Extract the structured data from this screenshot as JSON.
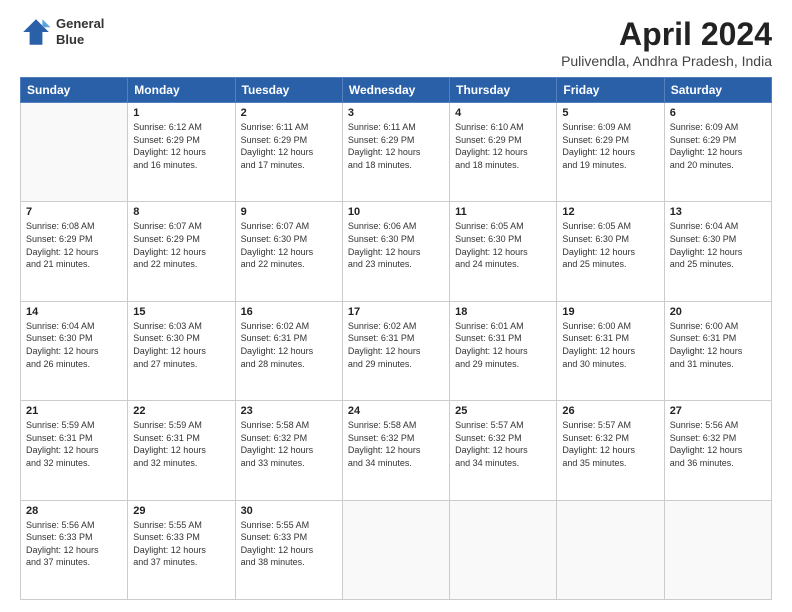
{
  "logo": {
    "line1": "General",
    "line2": "Blue"
  },
  "title": "April 2024",
  "location": "Pulivendla, Andhra Pradesh, India",
  "weekdays": [
    "Sunday",
    "Monday",
    "Tuesday",
    "Wednesday",
    "Thursday",
    "Friday",
    "Saturday"
  ],
  "weeks": [
    [
      {
        "day": "",
        "text": ""
      },
      {
        "day": "1",
        "text": "Sunrise: 6:12 AM\nSunset: 6:29 PM\nDaylight: 12 hours\nand 16 minutes."
      },
      {
        "day": "2",
        "text": "Sunrise: 6:11 AM\nSunset: 6:29 PM\nDaylight: 12 hours\nand 17 minutes."
      },
      {
        "day": "3",
        "text": "Sunrise: 6:11 AM\nSunset: 6:29 PM\nDaylight: 12 hours\nand 18 minutes."
      },
      {
        "day": "4",
        "text": "Sunrise: 6:10 AM\nSunset: 6:29 PM\nDaylight: 12 hours\nand 18 minutes."
      },
      {
        "day": "5",
        "text": "Sunrise: 6:09 AM\nSunset: 6:29 PM\nDaylight: 12 hours\nand 19 minutes."
      },
      {
        "day": "6",
        "text": "Sunrise: 6:09 AM\nSunset: 6:29 PM\nDaylight: 12 hours\nand 20 minutes."
      }
    ],
    [
      {
        "day": "7",
        "text": "Sunrise: 6:08 AM\nSunset: 6:29 PM\nDaylight: 12 hours\nand 21 minutes."
      },
      {
        "day": "8",
        "text": "Sunrise: 6:07 AM\nSunset: 6:29 PM\nDaylight: 12 hours\nand 22 minutes."
      },
      {
        "day": "9",
        "text": "Sunrise: 6:07 AM\nSunset: 6:30 PM\nDaylight: 12 hours\nand 22 minutes."
      },
      {
        "day": "10",
        "text": "Sunrise: 6:06 AM\nSunset: 6:30 PM\nDaylight: 12 hours\nand 23 minutes."
      },
      {
        "day": "11",
        "text": "Sunrise: 6:05 AM\nSunset: 6:30 PM\nDaylight: 12 hours\nand 24 minutes."
      },
      {
        "day": "12",
        "text": "Sunrise: 6:05 AM\nSunset: 6:30 PM\nDaylight: 12 hours\nand 25 minutes."
      },
      {
        "day": "13",
        "text": "Sunrise: 6:04 AM\nSunset: 6:30 PM\nDaylight: 12 hours\nand 25 minutes."
      }
    ],
    [
      {
        "day": "14",
        "text": "Sunrise: 6:04 AM\nSunset: 6:30 PM\nDaylight: 12 hours\nand 26 minutes."
      },
      {
        "day": "15",
        "text": "Sunrise: 6:03 AM\nSunset: 6:30 PM\nDaylight: 12 hours\nand 27 minutes."
      },
      {
        "day": "16",
        "text": "Sunrise: 6:02 AM\nSunset: 6:31 PM\nDaylight: 12 hours\nand 28 minutes."
      },
      {
        "day": "17",
        "text": "Sunrise: 6:02 AM\nSunset: 6:31 PM\nDaylight: 12 hours\nand 29 minutes."
      },
      {
        "day": "18",
        "text": "Sunrise: 6:01 AM\nSunset: 6:31 PM\nDaylight: 12 hours\nand 29 minutes."
      },
      {
        "day": "19",
        "text": "Sunrise: 6:00 AM\nSunset: 6:31 PM\nDaylight: 12 hours\nand 30 minutes."
      },
      {
        "day": "20",
        "text": "Sunrise: 6:00 AM\nSunset: 6:31 PM\nDaylight: 12 hours\nand 31 minutes."
      }
    ],
    [
      {
        "day": "21",
        "text": "Sunrise: 5:59 AM\nSunset: 6:31 PM\nDaylight: 12 hours\nand 32 minutes."
      },
      {
        "day": "22",
        "text": "Sunrise: 5:59 AM\nSunset: 6:31 PM\nDaylight: 12 hours\nand 32 minutes."
      },
      {
        "day": "23",
        "text": "Sunrise: 5:58 AM\nSunset: 6:32 PM\nDaylight: 12 hours\nand 33 minutes."
      },
      {
        "day": "24",
        "text": "Sunrise: 5:58 AM\nSunset: 6:32 PM\nDaylight: 12 hours\nand 34 minutes."
      },
      {
        "day": "25",
        "text": "Sunrise: 5:57 AM\nSunset: 6:32 PM\nDaylight: 12 hours\nand 34 minutes."
      },
      {
        "day": "26",
        "text": "Sunrise: 5:57 AM\nSunset: 6:32 PM\nDaylight: 12 hours\nand 35 minutes."
      },
      {
        "day": "27",
        "text": "Sunrise: 5:56 AM\nSunset: 6:32 PM\nDaylight: 12 hours\nand 36 minutes."
      }
    ],
    [
      {
        "day": "28",
        "text": "Sunrise: 5:56 AM\nSunset: 6:33 PM\nDaylight: 12 hours\nand 37 minutes."
      },
      {
        "day": "29",
        "text": "Sunrise: 5:55 AM\nSunset: 6:33 PM\nDaylight: 12 hours\nand 37 minutes."
      },
      {
        "day": "30",
        "text": "Sunrise: 5:55 AM\nSunset: 6:33 PM\nDaylight: 12 hours\nand 38 minutes."
      },
      {
        "day": "",
        "text": ""
      },
      {
        "day": "",
        "text": ""
      },
      {
        "day": "",
        "text": ""
      },
      {
        "day": "",
        "text": ""
      }
    ]
  ]
}
